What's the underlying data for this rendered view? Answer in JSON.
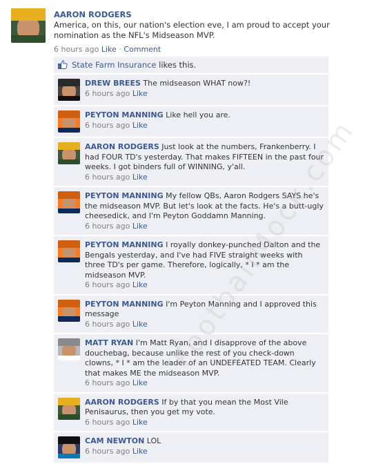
{
  "post": {
    "author": "AARON RODGERS",
    "text": "America, on this, our nation's election eve, I am proud to accept your nomination as the NFL's Midseason MVP.",
    "time": "6 hours ago",
    "like_label": "Like",
    "separator": "·",
    "comment_label": "Comment"
  },
  "likes": {
    "page_name": "State Farm Insurance",
    "suffix": " likes this."
  },
  "comments": [
    {
      "author": "DREW BREES",
      "text": "The midseason WHAT now?!",
      "time": "6 hours ago",
      "like": "Like",
      "avatar": "drew"
    },
    {
      "author": "PEYTON MANNING",
      "text": "Like hell you are.",
      "time": "6 hours ago",
      "like": "Like",
      "avatar": "peyton"
    },
    {
      "author": "AARON RODGERS",
      "text": "Just look at the numbers, Frankenberry. I had FOUR TD's yesterday. That makes FIFTEEN in the past four weeks. I got binders full of WINNING, y'all.",
      "time": "6 hours ago",
      "like": "Like",
      "avatar": "aaron"
    },
    {
      "author": "PEYTON MANNING",
      "text": "My fellow QBs, Aaron Rodgers SAYS he's the midseason MVP. But let's look at the facts. He's a butt-ugly cheesedick, and I'm Peyton Goddamn Manning.",
      "time": "6 hours ago",
      "like": "Like",
      "avatar": "peyton"
    },
    {
      "author": "PEYTON MANNING",
      "text": "I royally donkey-punched Dalton and the Bengals yesterday, and I've had FIVE straight weeks with three TD's per game. Therefore, logically, * I * am the midseason MVP.",
      "time": "6 hours ago",
      "like": "Like",
      "avatar": "peyton"
    },
    {
      "author": "PEYTON MANNING",
      "text": "I'm Peyton Manning and I approved this message",
      "time": "6 hours ago",
      "like": "Like",
      "avatar": "peyton"
    },
    {
      "author": "MATT RYAN",
      "text": "I'm Matt Ryan, and I disapprove of the above douchebag, because unlike the rest of you check-down clowns, * I * am the leader of an UNDEFEATED TEAM. Clearly that makes ME the midseason MVP.",
      "time": "6 hours ago",
      "like": "Like",
      "avatar": "matt"
    },
    {
      "author": "AARON RODGERS",
      "text": "If by that you mean the Most Vile Penisaurus, then you get my vote.",
      "time": "6 hours ago",
      "like": "Like",
      "avatar": "aaron"
    },
    {
      "author": "CAM NEWTON",
      "text": "LOL",
      "time": "6 hours ago",
      "like": "Like",
      "avatar": "cam"
    }
  ],
  "watermark": "FootballMock.com",
  "colors": {
    "link": "#3b5998",
    "comment_bg": "#edeff4",
    "meta": "#808080"
  }
}
